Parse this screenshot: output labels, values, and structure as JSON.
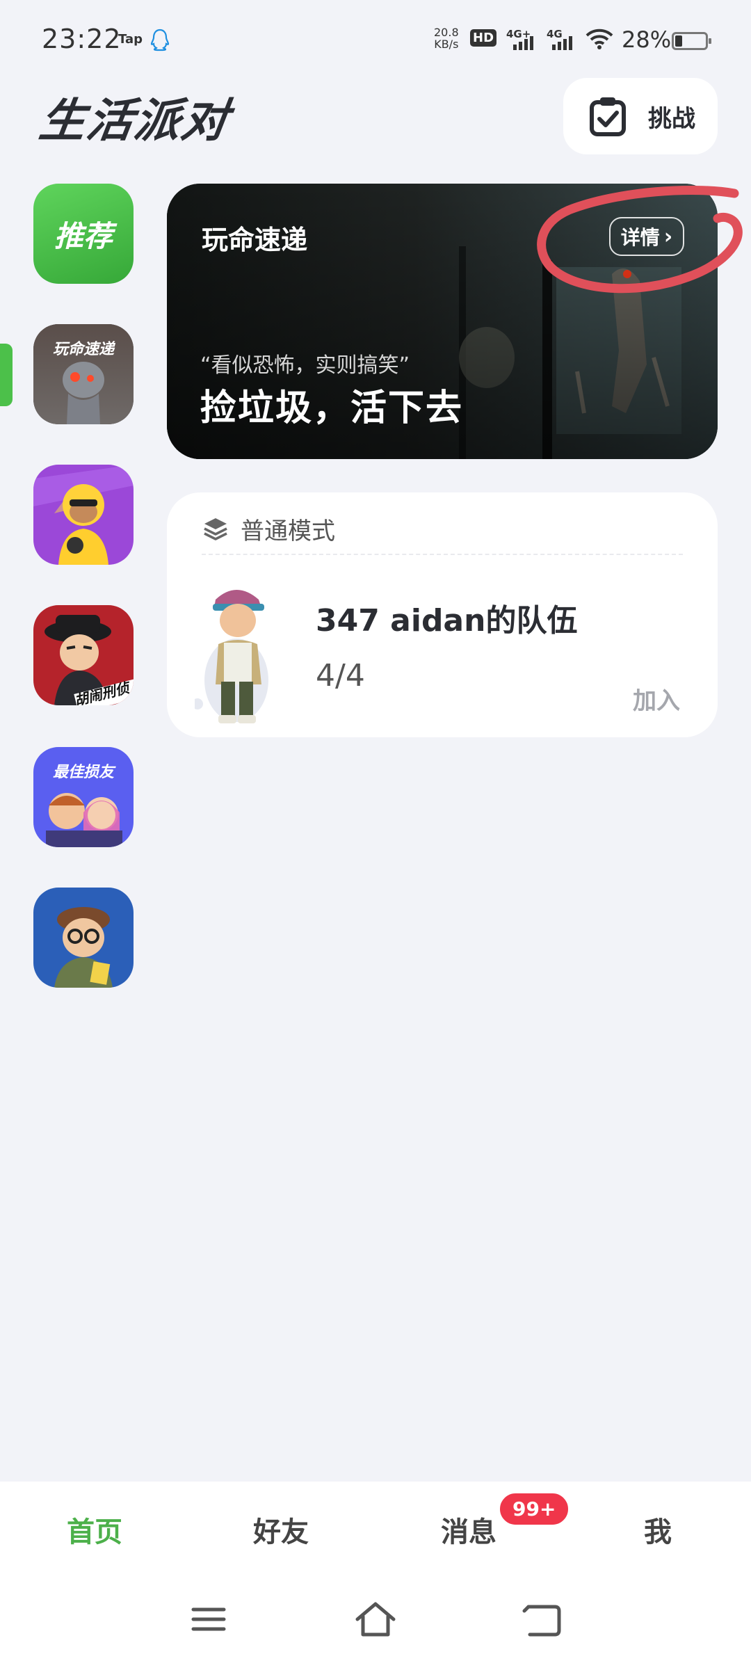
{
  "status_bar": {
    "time": "23:22",
    "tap_label": "Tap",
    "net_speed_value": "20.8",
    "net_speed_unit": "KB/s",
    "hd_label": "HD",
    "sim1": "4G⁺",
    "sim2": "4G",
    "battery_percent": "28%"
  },
  "header": {
    "app_logo": "生活派对",
    "challenge_label": "挑战"
  },
  "sidebar": {
    "recommend_label": "推荐",
    "game1_tag": "玩命速递",
    "game5_tag": "最佳损友",
    "game3_tag": "胡闹刑侦"
  },
  "banner": {
    "title": "玩命速递",
    "detail_label": "详情",
    "quote": "“看似恐怖，实则搞笑”",
    "slogan": "捡垃圾，活下去"
  },
  "team_card": {
    "mode_label": "普通模式",
    "team_name": "347 aidan的队伍",
    "member_count": "4/4",
    "join_label": "加入"
  },
  "bottom_nav": {
    "home": "首页",
    "friends": "好友",
    "messages": "消息",
    "messages_badge": "99+",
    "me": "我"
  },
  "colors": {
    "accent_green": "#4cb04a",
    "badge_red": "#f0364a",
    "annotation_red": "#e0505a",
    "background": "#f2f3f8"
  }
}
